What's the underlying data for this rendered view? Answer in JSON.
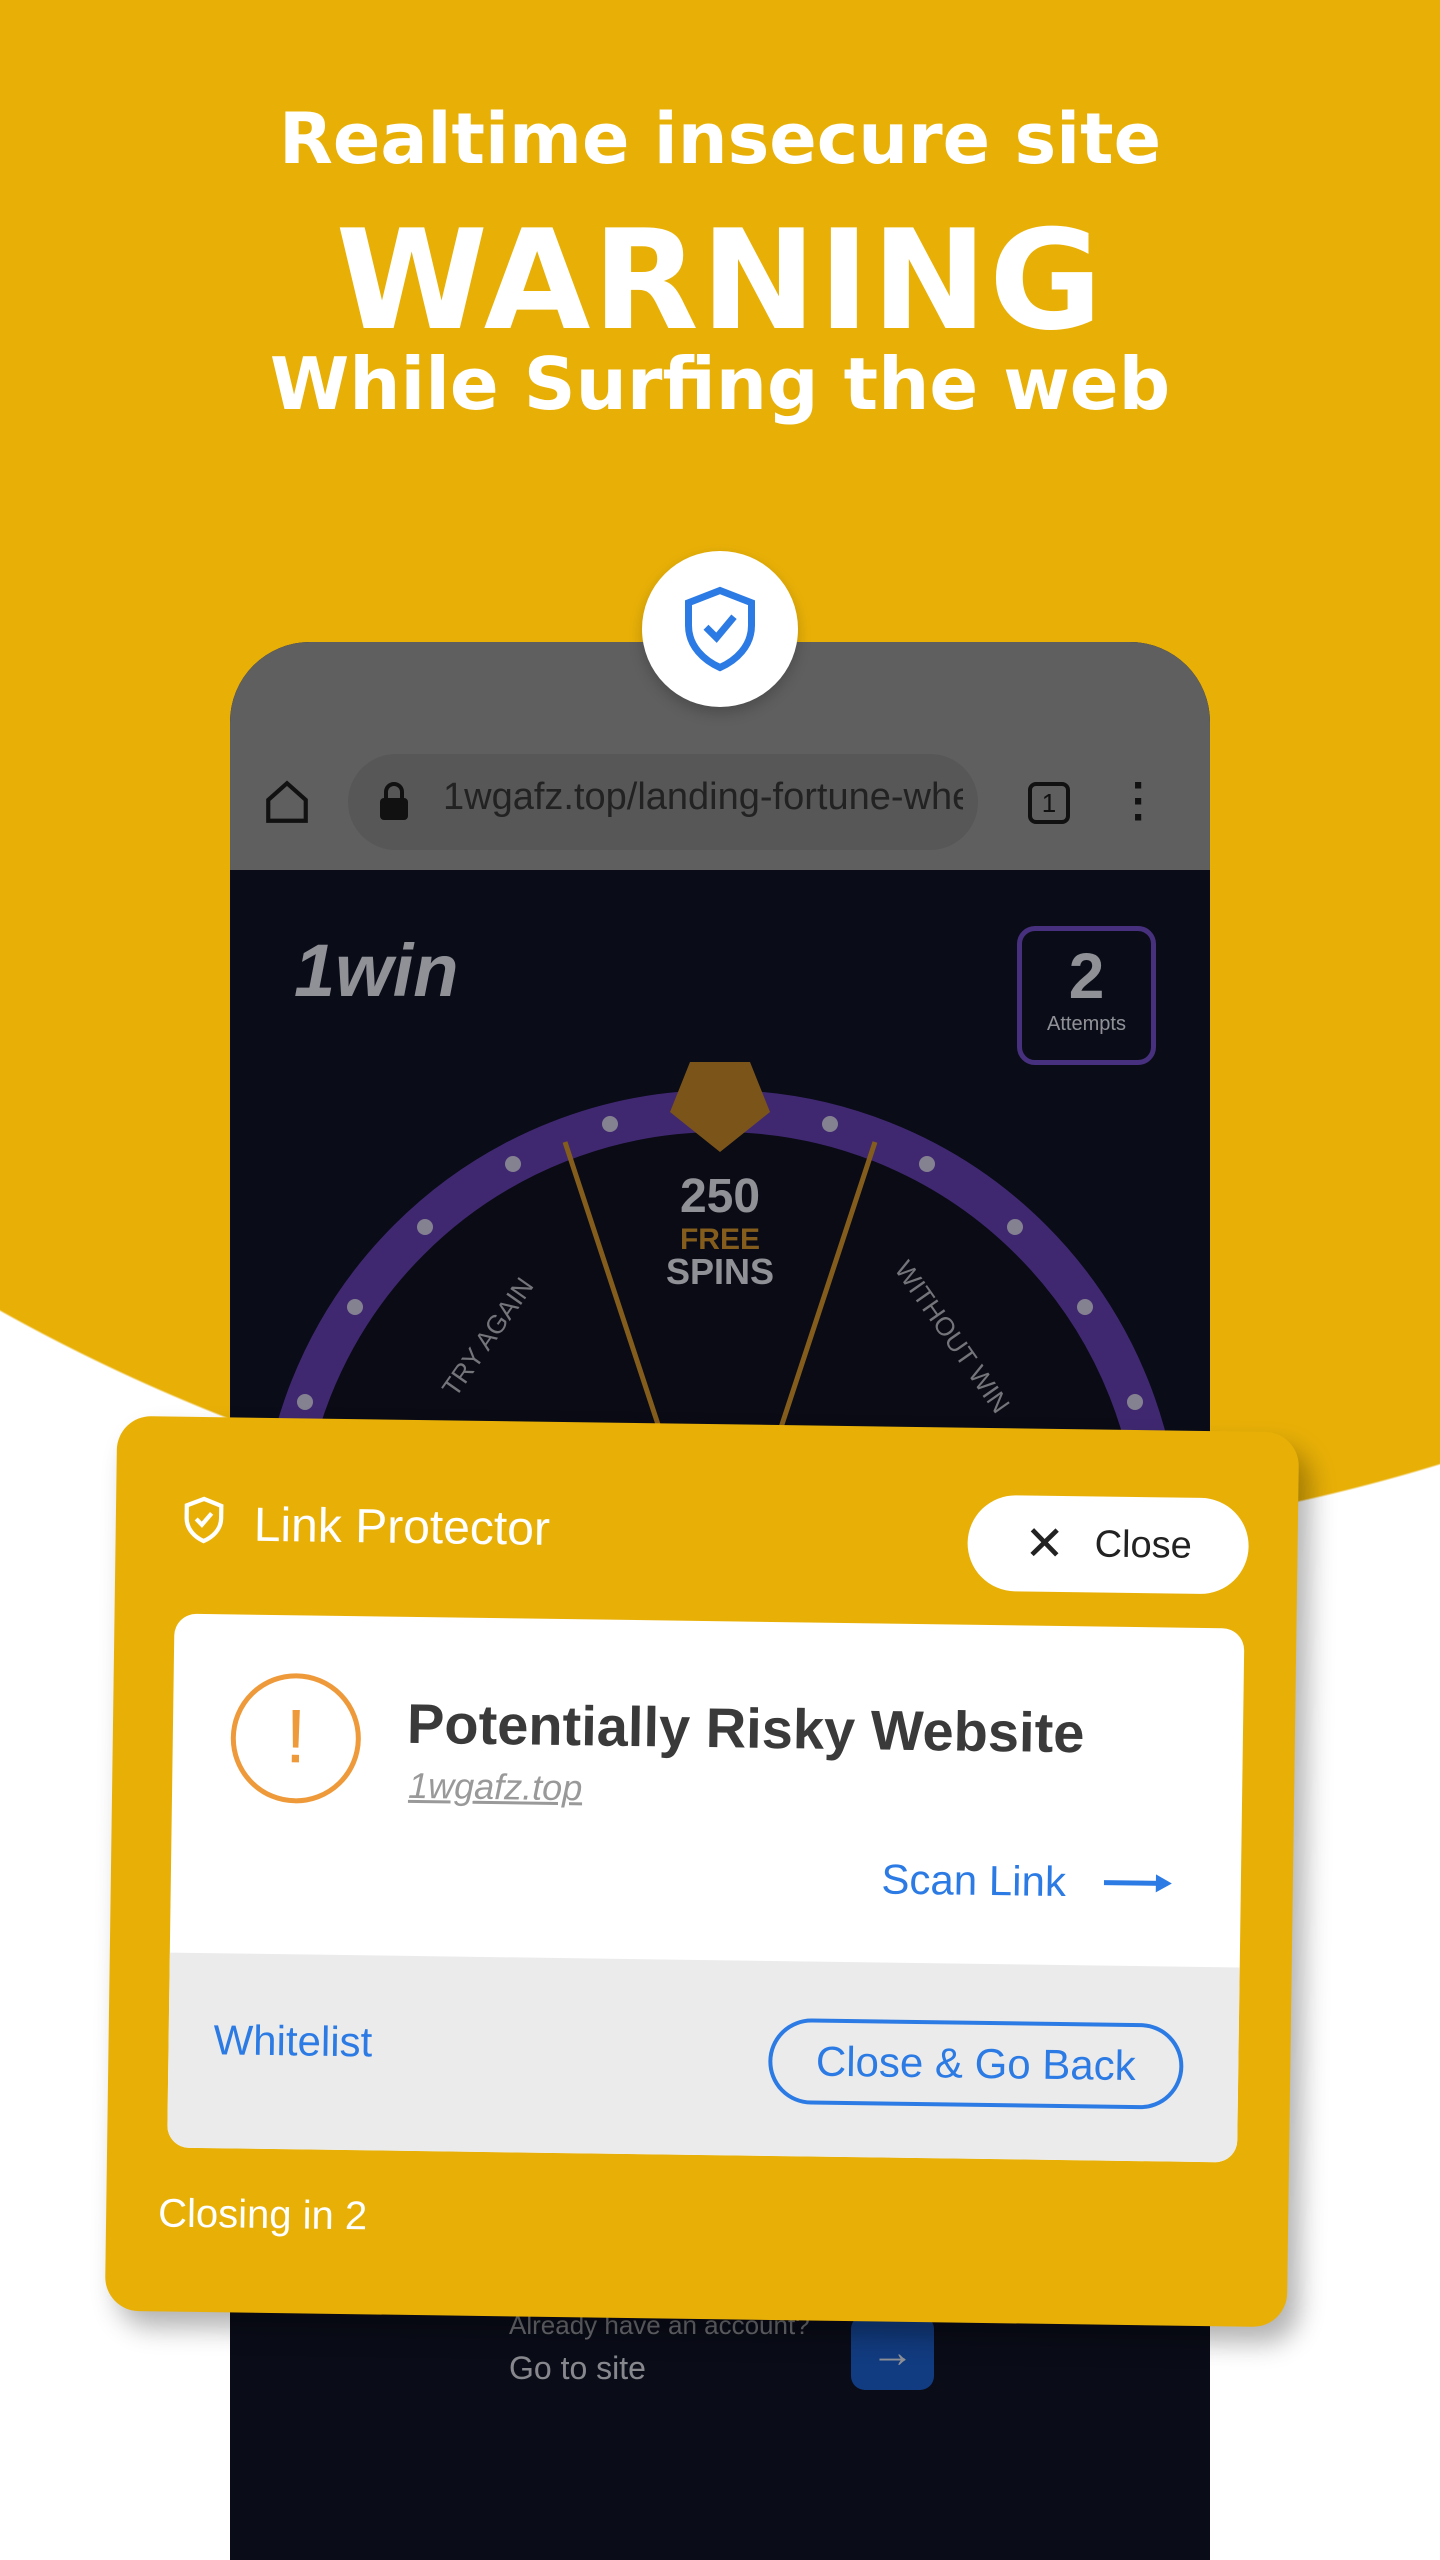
{
  "headline": {
    "line1": "Realtime insecure site",
    "line2": "WARNING",
    "line3": "While Surfing the web"
  },
  "colors": {
    "brand_yellow": "#E8B007",
    "link_blue": "#2C7BE5",
    "warning_orange": "#EE9A3A"
  },
  "browser": {
    "url": "1wgafz.top/landing-fortune-whe",
    "tab_count": "1",
    "icons": [
      "home-icon",
      "lock-icon",
      "tabs-icon",
      "more-vert-icon"
    ]
  },
  "site": {
    "logo": "1win",
    "attempts_count": "2",
    "attempts_label": "Attempts",
    "wheel": {
      "center_amount": "250",
      "center_free": "FREE",
      "center_spins": "SPINS",
      "left": "TRY AGAIN",
      "right": "WITHOUT WIN"
    },
    "account_prompt": "Already have an account?",
    "go_to_site": "Go to site"
  },
  "popup": {
    "title": "Link Protector",
    "close_label": "Close",
    "warning_title": "Potentially Risky Website",
    "domain": "1wgafz.top",
    "scan_link": "Scan Link",
    "whitelist": "Whitelist",
    "close_go_back": "Close & Go Back",
    "countdown": "Closing in 2"
  }
}
